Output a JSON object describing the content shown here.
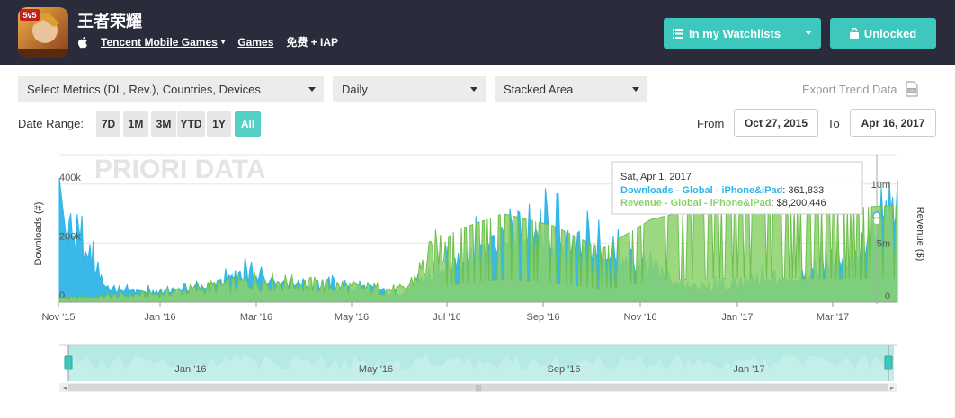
{
  "app": {
    "name": "王者荣耀",
    "publisher": "Tencent Mobile Games",
    "category": "Games",
    "price": "免费 + IAP",
    "icon_badge": "5v5"
  },
  "header_buttons": {
    "watchlist": "In my Watchlists",
    "unlocked": "Unlocked"
  },
  "controls": {
    "metrics": "Select Metrics (DL, Rev.), Countries, Devices",
    "interval": "Daily",
    "chart_type": "Stacked Area",
    "export": "Export Trend Data"
  },
  "date_range": {
    "label": "Date Range:",
    "buttons": [
      "7D",
      "1M",
      "3M",
      "YTD",
      "1Y",
      "All"
    ],
    "active": "All",
    "from_label": "From",
    "from": "Oct 27, 2015",
    "to_label": "To",
    "to": "Apr 16, 2017"
  },
  "chart_data": {
    "type": "area",
    "watermark": "PRIORI DATA",
    "ylabel_left": "Downloads (#)",
    "ylabel_right": "Revenue ($)",
    "left_ticks": [
      "400k",
      "200k",
      "0"
    ],
    "right_ticks": [
      "10m",
      "5m",
      "0"
    ],
    "x_ticks": [
      "Nov '15",
      "Jan '16",
      "Mar '16",
      "May '16",
      "Jul '16",
      "Sep '16",
      "Nov '16",
      "Jan '17",
      "Mar '17"
    ],
    "navigator_ticks": [
      "Jan '16",
      "May '16",
      "Sep '16",
      "Jan '17"
    ],
    "colors": {
      "downloads": "#2fb5e8",
      "revenue": "#8bd16a",
      "revenue_dark": "#6cbf4c",
      "navigator": "#a8e6df"
    },
    "series": [
      {
        "name": "Downloads - Global - iPhone&iPad",
        "x": [
          "Nov '15",
          "Dec '15",
          "Jan '16",
          "Feb '16",
          "Mar '16",
          "Apr '16",
          "May '16",
          "Jun '16",
          "Jul '16",
          "Aug '16",
          "Sep '16",
          "Oct '16",
          "Nov '16",
          "Dec '16",
          "Jan '17",
          "Feb '17",
          "Mar '17",
          "Apr '17"
        ],
        "values": [
          400000,
          60000,
          40000,
          70000,
          120000,
          80000,
          60000,
          40000,
          180000,
          320000,
          280000,
          240000,
          130000,
          60000,
          80000,
          120000,
          200000,
          361833
        ]
      },
      {
        "name": "Revenue - Global - iPhone&iPad",
        "x": [
          "Nov '15",
          "Dec '15",
          "Jan '16",
          "Feb '16",
          "Mar '16",
          "Apr '16",
          "May '16",
          "Jun '16",
          "Jul '16",
          "Aug '16",
          "Sep '16",
          "Oct '16",
          "Nov '16",
          "Dec '16",
          "Jan '17",
          "Feb '17",
          "Mar '17",
          "Apr '17"
        ],
        "values": [
          300000,
          500000,
          700000,
          1200000,
          1800000,
          1500000,
          1200000,
          1000000,
          6000000,
          7500000,
          6500000,
          4500000,
          7000000,
          8000000,
          8200000,
          8000000,
          8000000,
          8200446
        ]
      }
    ],
    "tooltip": {
      "date": "Sat, Apr 1, 2017",
      "downloads_label": "Downloads - Global - iPhone&iPad",
      "downloads_value": "361,833",
      "revenue_label": "Revenue - Global - iPhone&iPad",
      "revenue_value": "$8,200,446"
    }
  }
}
